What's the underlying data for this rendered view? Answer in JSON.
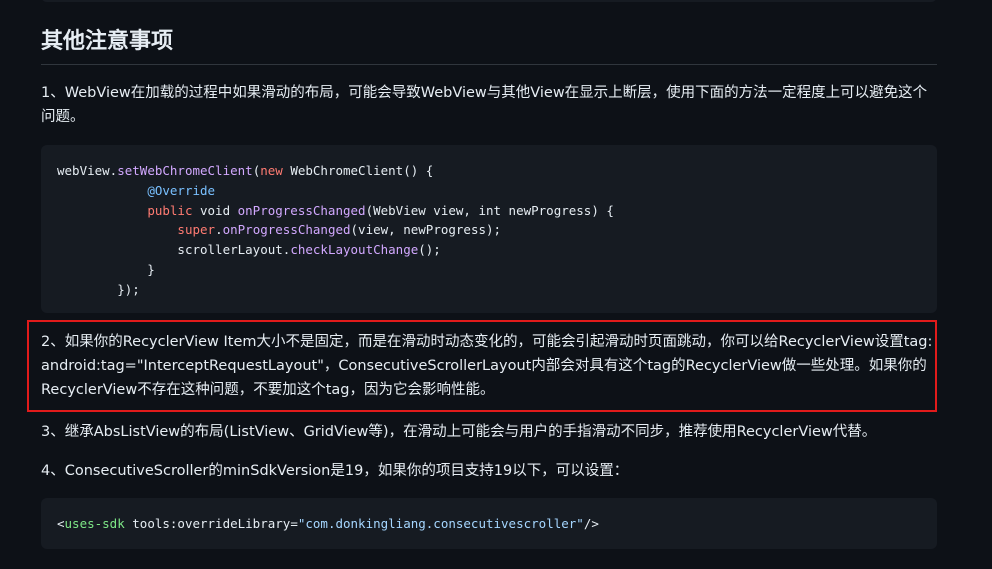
{
  "section": {
    "title": "其他注意事项"
  },
  "paragraphs": {
    "p1": "1、WebView在加载的过程中如果滑动的布局，可能会导致WebView与其他View在显示上断层，使用下面的方法一定程度上可以避免这个问题。",
    "p2": "2、如果你的RecyclerView Item大小不是固定，而是在滑动时动态变化的，可能会引起滑动时页面跳动，你可以给RecyclerView设置tag: android:tag=\"InterceptRequestLayout\"，ConsecutiveScrollerLayout内部会对具有这个tag的RecyclerView做一些处理。如果你的RecyclerView不存在这种问题，不要加这个tag，因为它会影响性能。",
    "p3": "3、继承AbsListView的布局(ListView、GridView等)，在滑动上可能会与用户的手指滑动不同步，推荐使用RecyclerView代替。",
    "p4": "4、ConsecutiveScroller的minSdkVersion是19，如果你的项目支持19以下，可以设置："
  },
  "code1": {
    "l1_a": "webView.",
    "l1_b": "setWebChromeClient",
    "l1_c": "(",
    "l1_d": "new",
    "l1_e": " WebChromeClient() {",
    "l2_indent": "            ",
    "l2_a": "@Override",
    "l3_indent": "            ",
    "l3_a": "public",
    "l3_b": " void ",
    "l3_c": "onProgressChanged",
    "l3_d": "(WebView view, int newProgress) {",
    "l4_indent": "                ",
    "l4_a": "super",
    "l4_b": ".",
    "l4_c": "onProgressChanged",
    "l4_d": "(view, newProgress);",
    "l5_indent": "                ",
    "l5_a": "scrollerLayout.",
    "l5_b": "checkLayoutChange",
    "l5_c": "();",
    "l6": "            }",
    "l7": "        });"
  },
  "code2": {
    "a": "<",
    "b": "uses-sdk",
    "c": " tools:overrideLibrary=",
    "d": "\"com.donkingliang.consecutivescroller\"",
    "e": "/>"
  },
  "colors": {
    "background": "#0d1117",
    "code_background": "#161b22",
    "highlight_border": "#e11b1b"
  }
}
